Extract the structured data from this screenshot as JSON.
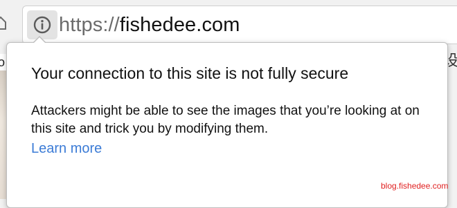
{
  "toolbar": {
    "home_icon": "home-icon",
    "site_info_icon": "info-circle-icon"
  },
  "omnibox": {
    "url_scheme": "https://",
    "url_host": "fishedee.com"
  },
  "page_behind": {
    "left_fragment": "o",
    "right_fragment": "设"
  },
  "popup": {
    "title": "Your connection to this site is not fully secure",
    "body": "Attackers might be able to see the images that you’re looking at on this site and trick you by modifying them.",
    "learn_more_label": "Learn more",
    "link_color": "#3b7bd6"
  },
  "watermark": {
    "text": "blog.fishedee.com",
    "color": "#e02020"
  }
}
